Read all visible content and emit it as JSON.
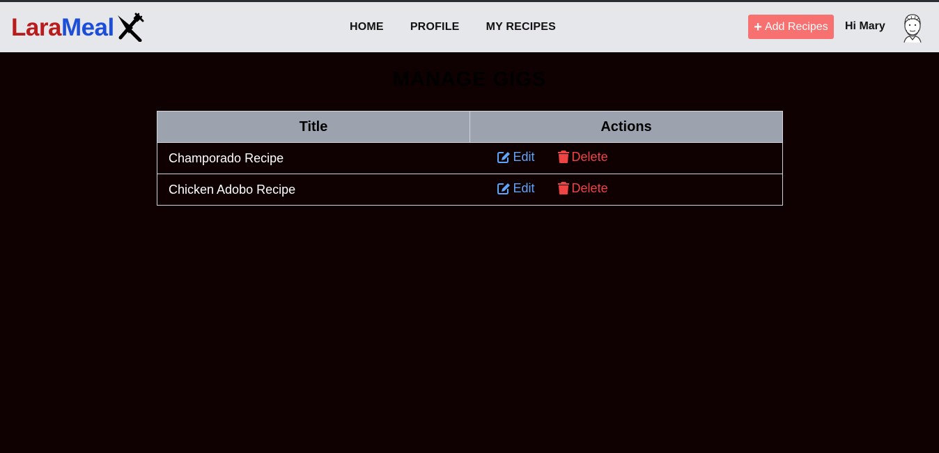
{
  "brand": {
    "part1": "Lara",
    "part2": "Meal",
    "icon": "fork-knife-icon"
  },
  "nav": {
    "links": [
      "HOME",
      "PROFILE",
      "MY RECIPES"
    ]
  },
  "header": {
    "add_label": "Add Recipes",
    "greeting": "Hi Mary",
    "avatar_icon": "chef-avatar"
  },
  "page": {
    "title": "MANAGE GIGS"
  },
  "table": {
    "headers": [
      "Title",
      "Actions"
    ],
    "rows": [
      {
        "title": "Champorado Recipe",
        "edit": "Edit",
        "delete": "Delete"
      },
      {
        "title": "Chicken Adobo Recipe",
        "edit": "Edit",
        "delete": "Delete"
      }
    ]
  },
  "colors": {
    "background": "#0f0002",
    "navbar": "#e5e7eb",
    "brand_red": "#b91c1c",
    "brand_blue": "#1d4ed8",
    "add_button": "#f87171",
    "edit": "#60a5fa",
    "delete": "#ef4444",
    "table_header": "#9ca3af"
  }
}
